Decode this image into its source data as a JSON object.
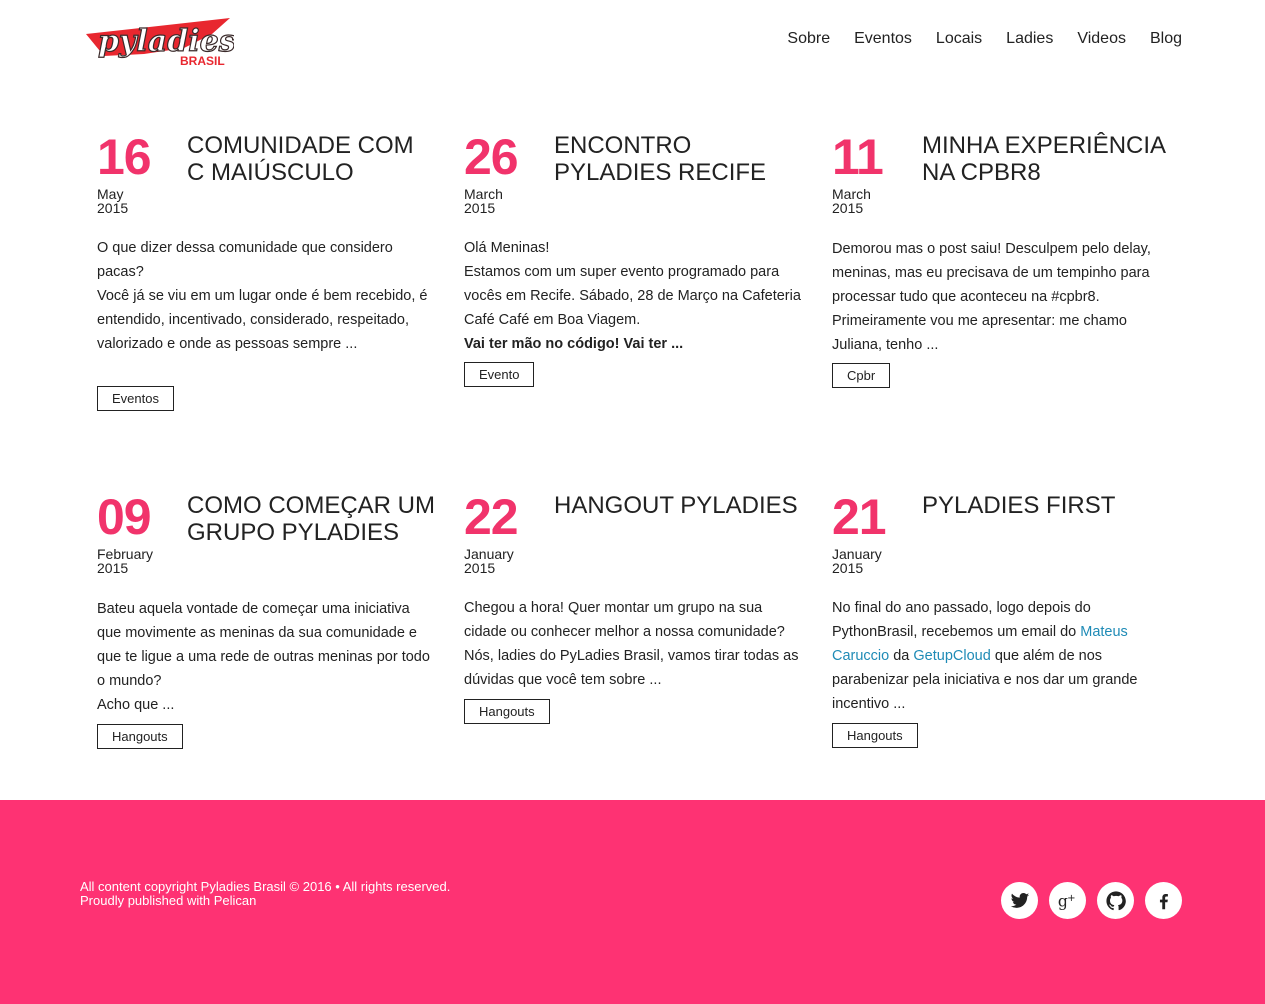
{
  "header": {
    "logo_text": "pyladies",
    "logo_sub": "BRASIL",
    "nav": [
      "Sobre",
      "Eventos",
      "Locais",
      "Ladies",
      "Videos",
      "Blog"
    ]
  },
  "posts": [
    {
      "day": "16",
      "month": "May",
      "year": "2015",
      "title": "COMUNIDADE COM C MAIÚSCULO",
      "excerpt": "O que dizer dessa comunidade que considero pacas?\nVocê já se viu em um lugar onde é bem recebido, é entendido, incentivado, considerado, respeitado, valorizado e onde as pessoas sempre ...",
      "tag": "Eventos"
    },
    {
      "day": "26",
      "month": "March",
      "year": "2015",
      "title": "ENCONTRO PYLADIES RECIFE",
      "excerpt": "Olá Meninas!\nEstamos com um super evento programado para vocês em Recife. Sábado, 28 de Março na Cafeteria Café Café em Boa Viagem.",
      "excerpt_bold": "Vai ter mão no código! Vai ter ...",
      "tag": "Evento"
    },
    {
      "day": "11",
      "month": "March",
      "year": "2015",
      "title": "MINHA EXPERIÊNCIA NA CPBR8",
      "excerpt": "Demorou mas o post saiu! Desculpem pelo delay, meninas, mas eu precisava de um tempinho para processar tudo que aconteceu na #cpbr8.\nPrimeiramente vou me apresentar: me chamo Juliana, tenho ...",
      "tag": "Cpbr"
    },
    {
      "day": "09",
      "month": "February",
      "year": "2015",
      "title": "COMO COMEÇAR UM GRUPO PYLADIES",
      "excerpt": "Bateu aquela vontade de começar uma iniciativa que movimente as meninas da sua comunidade e que te ligue a uma rede de outras meninas por todo o mundo?\nAcho que ...",
      "tag": "Hangouts"
    },
    {
      "day": "22",
      "month": "January",
      "year": "2015",
      "title": "HANGOUT PYLADIES",
      "excerpt": "Chegou a hora! Quer montar um grupo na sua cidade ou conhecer melhor a nossa comunidade? Nós, ladies do PyLadies Brasil, vamos tirar todas as dúvidas que você tem sobre ...",
      "tag": "Hangouts"
    },
    {
      "day": "21",
      "month": "January",
      "year": "2015",
      "title": "PYLADIES FIRST",
      "excerpt_pre": "No final do ano passado, logo depois do PythonBrasil, recebemos um email do ",
      "link1": "Mateus Caruccio",
      "excerpt_mid": " da ",
      "link2": "GetupCloud",
      "excerpt_post": " que além de nos parabenizar pela iniciativa e nos dar um grande incentivo ...",
      "tag": "Hangouts"
    }
  ],
  "footer": {
    "copyright": "All content copyright Pyladies Brasil © 2016 • All rights reserved.",
    "published": "Proudly published with Pelican",
    "social": [
      "twitter-icon",
      "google-plus-icon",
      "github-icon",
      "facebook-icon"
    ]
  },
  "colors": {
    "accent": "#f1336b",
    "footer_bg": "#fe3273",
    "link": "#1f8bb6"
  }
}
